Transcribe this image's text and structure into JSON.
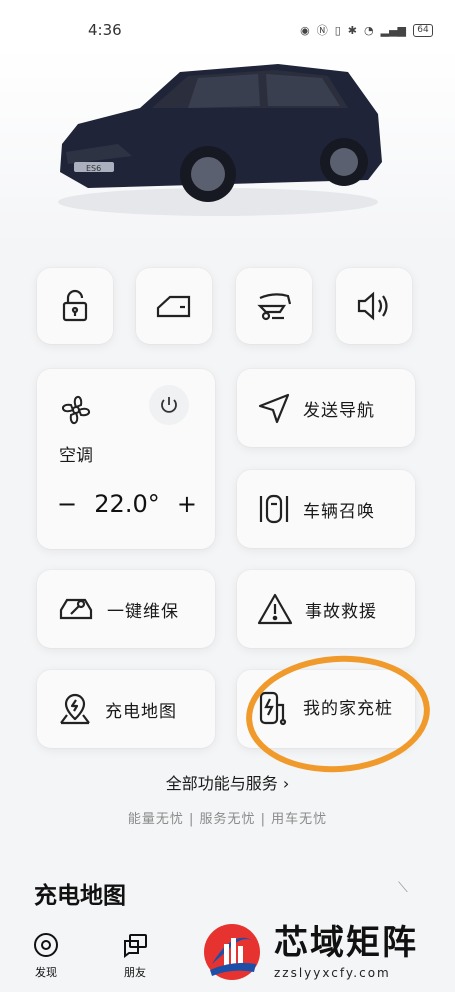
{
  "status_bar": {
    "time": "4:36",
    "battery": "64"
  },
  "hero": {
    "car_badge": "ES6",
    "colors": {
      "car_body": "#1f2438",
      "car_window": "#2b2f3d"
    }
  },
  "quick_controls": [
    {
      "name": "lock",
      "icon": "unlock-icon"
    },
    {
      "name": "window",
      "icon": "car-door-icon"
    },
    {
      "name": "tailgate",
      "icon": "tailgate-icon"
    },
    {
      "name": "horn",
      "icon": "speaker-icon"
    }
  ],
  "climate": {
    "label": "空调",
    "minus": "−",
    "temperature": "22.0°",
    "plus": "+"
  },
  "actions": {
    "send_navigation": "发送导航",
    "vehicle_summon": "车辆召唤",
    "maintenance": "一键维保",
    "rescue": "事故救援",
    "charging_map": "充电地图",
    "home_charger": "我的家充桩"
  },
  "more_link": "全部功能与服务 ›",
  "tagline": "能量无忧 | 服务无忧 | 用车无忧",
  "section": {
    "title": "充电地图"
  },
  "tabbar": [
    {
      "label": "发现",
      "icon": "discover-icon"
    },
    {
      "label": "朋友",
      "icon": "chat-icon"
    }
  ],
  "watermark": {
    "title": "芯域矩阵",
    "url": "zzslyyxcfy.com"
  },
  "colors": {
    "highlight": "#f19a2c",
    "background": "#f4f5f7",
    "card": "#fafafb"
  }
}
